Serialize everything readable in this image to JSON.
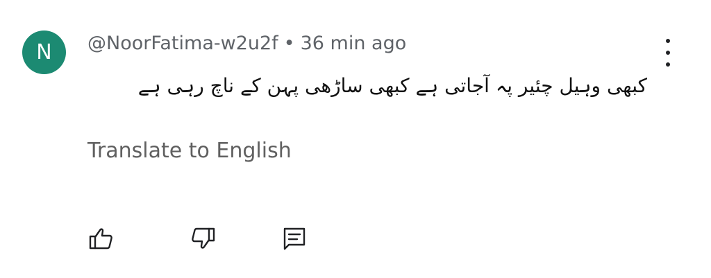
{
  "comment": {
    "avatar_letter": "N",
    "avatar_color": "#1c8a72",
    "author": "@NoorFatima-w2u2f",
    "separator": "•",
    "timestamp": "36 min ago",
    "text": "کبھی وہیل چئیر پہ آجاتی ہے کبھی ساڑھی پہن کے ناچ رہی ہے",
    "translate_label": "Translate to English"
  },
  "icons": {
    "more": "more-vert-icon",
    "like": "thumbs-up-icon",
    "dislike": "thumbs-down-icon",
    "reply": "reply-comment-icon"
  }
}
